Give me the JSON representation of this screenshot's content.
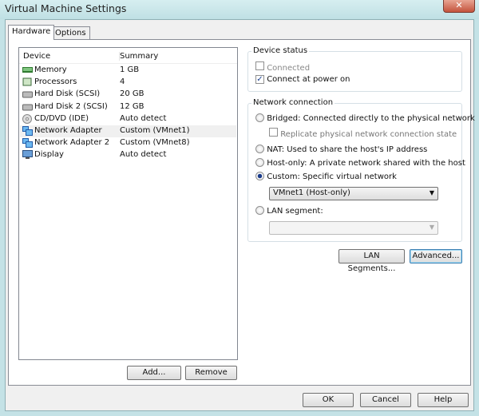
{
  "window": {
    "title": "Virtual Machine Settings",
    "close_glyph": "✕"
  },
  "tabs": [
    {
      "label": "Hardware",
      "active": true
    },
    {
      "label": "Options",
      "active": false
    }
  ],
  "device_list": {
    "headers": {
      "device": "Device",
      "summary": "Summary"
    },
    "rows": [
      {
        "device": "Memory",
        "summary": "1 GB",
        "icon": "memory-icon"
      },
      {
        "device": "Processors",
        "summary": "4",
        "icon": "processor-icon"
      },
      {
        "device": "Hard Disk (SCSI)",
        "summary": "20 GB",
        "icon": "hard-disk-icon"
      },
      {
        "device": "Hard Disk 2 (SCSI)",
        "summary": "12 GB",
        "icon": "hard-disk-icon"
      },
      {
        "device": "CD/DVD (IDE)",
        "summary": "Auto detect",
        "icon": "cd-dvd-icon"
      },
      {
        "device": "Network Adapter",
        "summary": "Custom (VMnet1)",
        "icon": "network-adapter-icon",
        "selected": true
      },
      {
        "device": "Network Adapter 2",
        "summary": "Custom (VMnet8)",
        "icon": "network-adapter-icon"
      },
      {
        "device": "Display",
        "summary": "Auto detect",
        "icon": "display-icon"
      }
    ]
  },
  "list_buttons": {
    "add": "Add...",
    "remove": "Remove"
  },
  "device_status": {
    "title": "Device status",
    "connected": {
      "label": "Connected",
      "checked": false,
      "disabled": true
    },
    "connect_power_on": {
      "label": "Connect at power on",
      "checked": true
    }
  },
  "network": {
    "title": "Network connection",
    "bridged": "Bridged: Connected directly to the physical network",
    "replicate": "Replicate physical network connection state",
    "nat": "NAT: Used to share the host's IP address",
    "hostonly": "Host-only: A private network shared with the host",
    "custom": "Custom: Specific virtual network",
    "custom_value": "VMnet1 (Host-only)",
    "lan": "LAN segment:",
    "lan_value": "",
    "selected": "custom"
  },
  "network_buttons": {
    "lan_segments": "LAN Segments...",
    "advanced": "Advanced..."
  },
  "footer": {
    "ok": "OK",
    "cancel": "Cancel",
    "help": "Help"
  }
}
